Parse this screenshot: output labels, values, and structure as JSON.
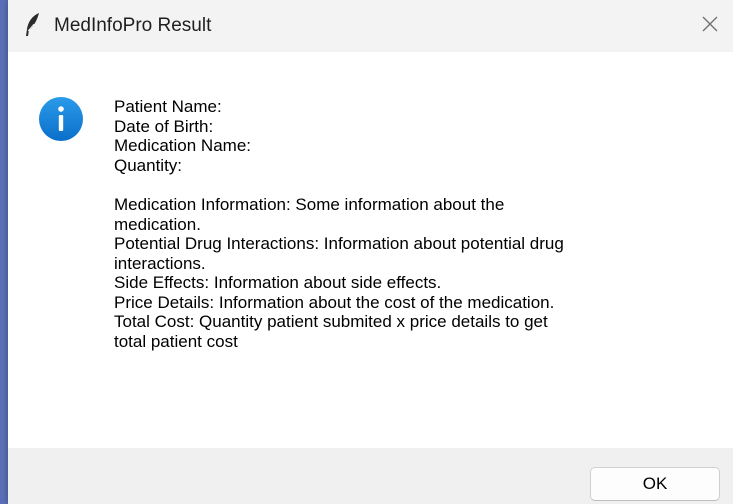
{
  "window": {
    "title": "MedInfoPro Result",
    "icon": "feather-icon",
    "close_icon": "close-icon"
  },
  "dialog": {
    "icon": "info-icon",
    "icon_color": "#0a7fd6",
    "lines": [
      "Patient Name:",
      "Date of Birth:",
      "Medication Name:",
      "Quantity:"
    ],
    "details": [
      "Medication Information: Some information about the",
      "medication.",
      "Potential Drug Interactions: Information about potential drug",
      "interactions.",
      "Side Effects: Information about side effects.",
      "Price Details: Information about the cost of the medication.",
      "Total Cost: Quantity patient submited x price details to get",
      "total patient cost"
    ]
  },
  "buttons": {
    "ok_label": "OK"
  }
}
